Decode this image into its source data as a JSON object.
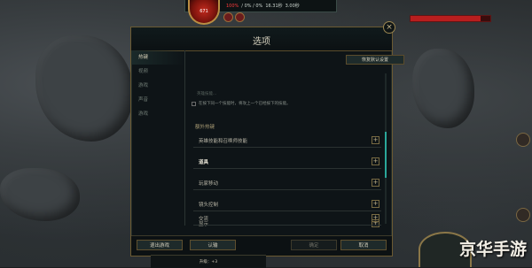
{
  "hud": {
    "level": "671",
    "stats": [
      "100%",
      "/ 0% / 0%",
      "16.31秒",
      "3.00秒"
    ]
  },
  "dialog": {
    "title": "选项",
    "close_label": "×",
    "defaults_label": "恢复默认设置",
    "faded_text": "英雄技能...",
    "hint_text": "在按下同一个技能时，将攻上一个已经按下的技能。",
    "section_title": "额外热键"
  },
  "sidebar": {
    "items": [
      {
        "label": "热键"
      },
      {
        "label": "视频"
      },
      {
        "label": "游戏"
      },
      {
        "label": "声音"
      },
      {
        "label": "游戏"
      }
    ]
  },
  "rows": [
    {
      "label": "英雄技能和召唤师技能"
    },
    {
      "label": "道具"
    },
    {
      "label": "玩家移动"
    },
    {
      "label": "镜头控制"
    },
    {
      "label": "显示"
    },
    {
      "label": "交流"
    }
  ],
  "buttons": {
    "quit": "退出游戏",
    "surrender": "认输",
    "confirm": "确定",
    "cancel": "取消"
  },
  "bottom_hud": "升级：+3",
  "watermark": "京华手游",
  "colors": {
    "accent_teal": "#2aa79a",
    "gold_border": "#6b5a32",
    "health_red": "#b81e1e"
  }
}
